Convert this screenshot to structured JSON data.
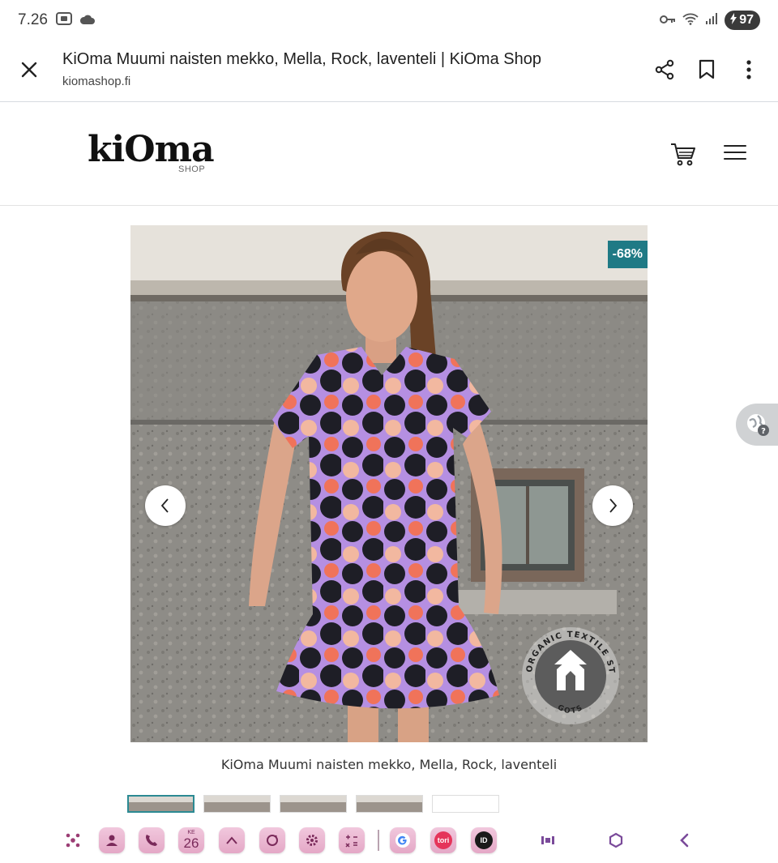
{
  "status_bar": {
    "time": "7.26",
    "battery": "97"
  },
  "browser": {
    "page_title": "KiOma Muumi naisten mekko, Mella, Rock, laventeli | KiOma Shop",
    "url": "kiomashop.fi",
    "icons": [
      "close-icon",
      "share-icon",
      "bookmark-icon",
      "more-vert-icon"
    ]
  },
  "site_header": {
    "logo_text": "kiOma",
    "logo_sub": "SHOP",
    "icons": [
      "cart-icon",
      "menu-icon"
    ]
  },
  "product": {
    "discount_badge": "-68%",
    "caption": "KiOma Muumi naisten mekko, Mella, Rock, laventeli",
    "gots_text_top": "GLOBAL ORGANIC TEXTILE STANDARD",
    "gots_text_bottom": "GOTS",
    "thumbnail_count": 5,
    "active_thumbnail": 1
  },
  "translate_bubble": {
    "icon": "translate-globe-icon"
  },
  "dock": {
    "apps": [
      "apps-icon",
      "contacts-icon",
      "phone-icon",
      "calendar-icon",
      "hat-icon",
      "camera-icon",
      "settings-icon",
      "calculator-icon",
      "google-icon",
      "tori-icon",
      "id-icon"
    ],
    "calendar_day": "26",
    "calendar_weekday": "KE",
    "tori_label": "tori",
    "id_label": "ID",
    "nav_icons": [
      "recents-icon",
      "home-icon",
      "back-icon"
    ]
  },
  "colors": {
    "accent": "#1f7a85",
    "dock_icon": "#e9b4cf",
    "dress_lavender": "#b58fe2",
    "dress_coral": "#f0735a",
    "dress_peach": "#f2b8a0"
  }
}
